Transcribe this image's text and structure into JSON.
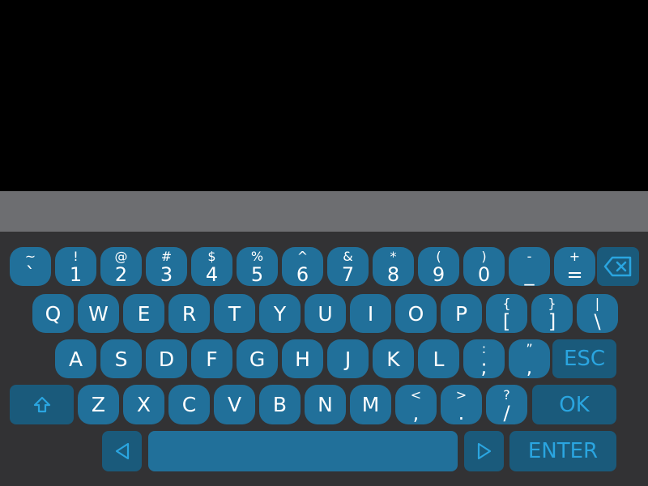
{
  "keyboard": {
    "row1": [
      {
        "shift": "~",
        "base": "`"
      },
      {
        "shift": "!",
        "base": "1"
      },
      {
        "shift": "@",
        "base": "2"
      },
      {
        "shift": "#",
        "base": "3"
      },
      {
        "shift": "$",
        "base": "4"
      },
      {
        "shift": "%",
        "base": "5"
      },
      {
        "shift": "^",
        "base": "6"
      },
      {
        "shift": "&",
        "base": "7"
      },
      {
        "shift": "*",
        "base": "8"
      },
      {
        "shift": "(",
        "base": "9"
      },
      {
        "shift": ")",
        "base": "0"
      },
      {
        "shift": "-",
        "base": "_"
      },
      {
        "shift": "+",
        "base": "="
      }
    ],
    "row2": [
      "Q",
      "W",
      "E",
      "R",
      "T",
      "Y",
      "U",
      "I",
      "O",
      "P"
    ],
    "row2_symbols": [
      {
        "shift": "{",
        "base": "["
      },
      {
        "shift": "}",
        "base": "]"
      },
      {
        "shift": "|",
        "base": "\\"
      }
    ],
    "row3": [
      "A",
      "S",
      "D",
      "F",
      "G",
      "H",
      "J",
      "K",
      "L"
    ],
    "row3_symbols": [
      {
        "shift": ":",
        "base": ";"
      },
      {
        "shift": "”",
        "base": ","
      }
    ],
    "row4": [
      "Z",
      "X",
      "C",
      "V",
      "B",
      "N",
      "M"
    ],
    "row4_symbols": [
      {
        "shift": "<",
        "base": ","
      },
      {
        "shift": ">",
        "base": "."
      },
      {
        "shift": "?",
        "base": "/"
      }
    ],
    "esc_label": "ESC",
    "ok_label": "OK",
    "enter_label": "ENTER",
    "icons": {
      "backspace": "backspace-icon",
      "shift": "shift-arrow-icon",
      "left": "left-arrow-icon",
      "right": "right-arrow-icon"
    },
    "colors": {
      "key": "#21709a",
      "key_dark": "#1a5a7b",
      "key_text": "#ffffff",
      "accent": "#2aa5e0",
      "keyboard_bg": "#323234",
      "input_bar": "#6d6e71"
    }
  }
}
